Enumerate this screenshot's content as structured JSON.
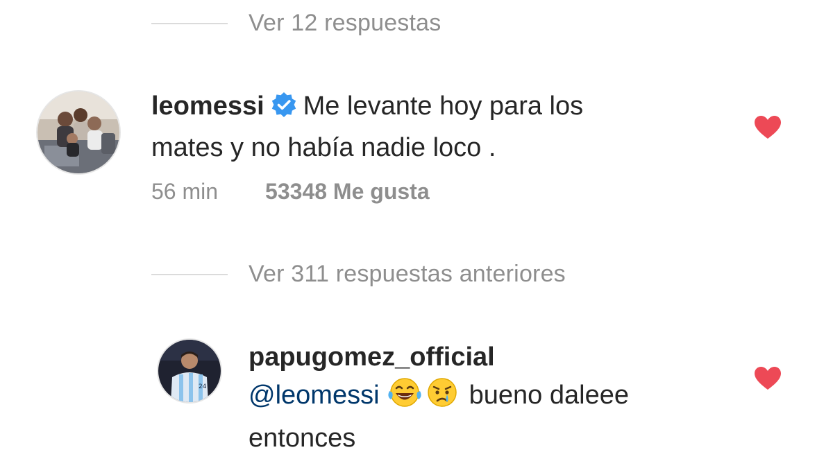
{
  "replies_top": {
    "label": "Ver 12 respuestas"
  },
  "comment1": {
    "username": "leomessi",
    "text_line1": "Me levante hoy para los",
    "text_line2": "mates y no había nadie loco .",
    "time": "56 min",
    "likes": "53348 Me gusta",
    "liked": true,
    "verified_icon": "verified-badge-icon",
    "heart_color": "#ed4956",
    "verified_color": "#3897f0"
  },
  "replies_prev": {
    "label": "Ver 311 respuestas anteriores"
  },
  "comment2": {
    "username": "papugomez_official",
    "mention": "@leomessi",
    "emojis": [
      "laughing-tears-emoji",
      "crying-face-emoji"
    ],
    "text_after": "bueno daleee",
    "text_line2": "entonces",
    "liked": true,
    "heart_color": "#ed4956",
    "mention_color": "#00376b"
  }
}
